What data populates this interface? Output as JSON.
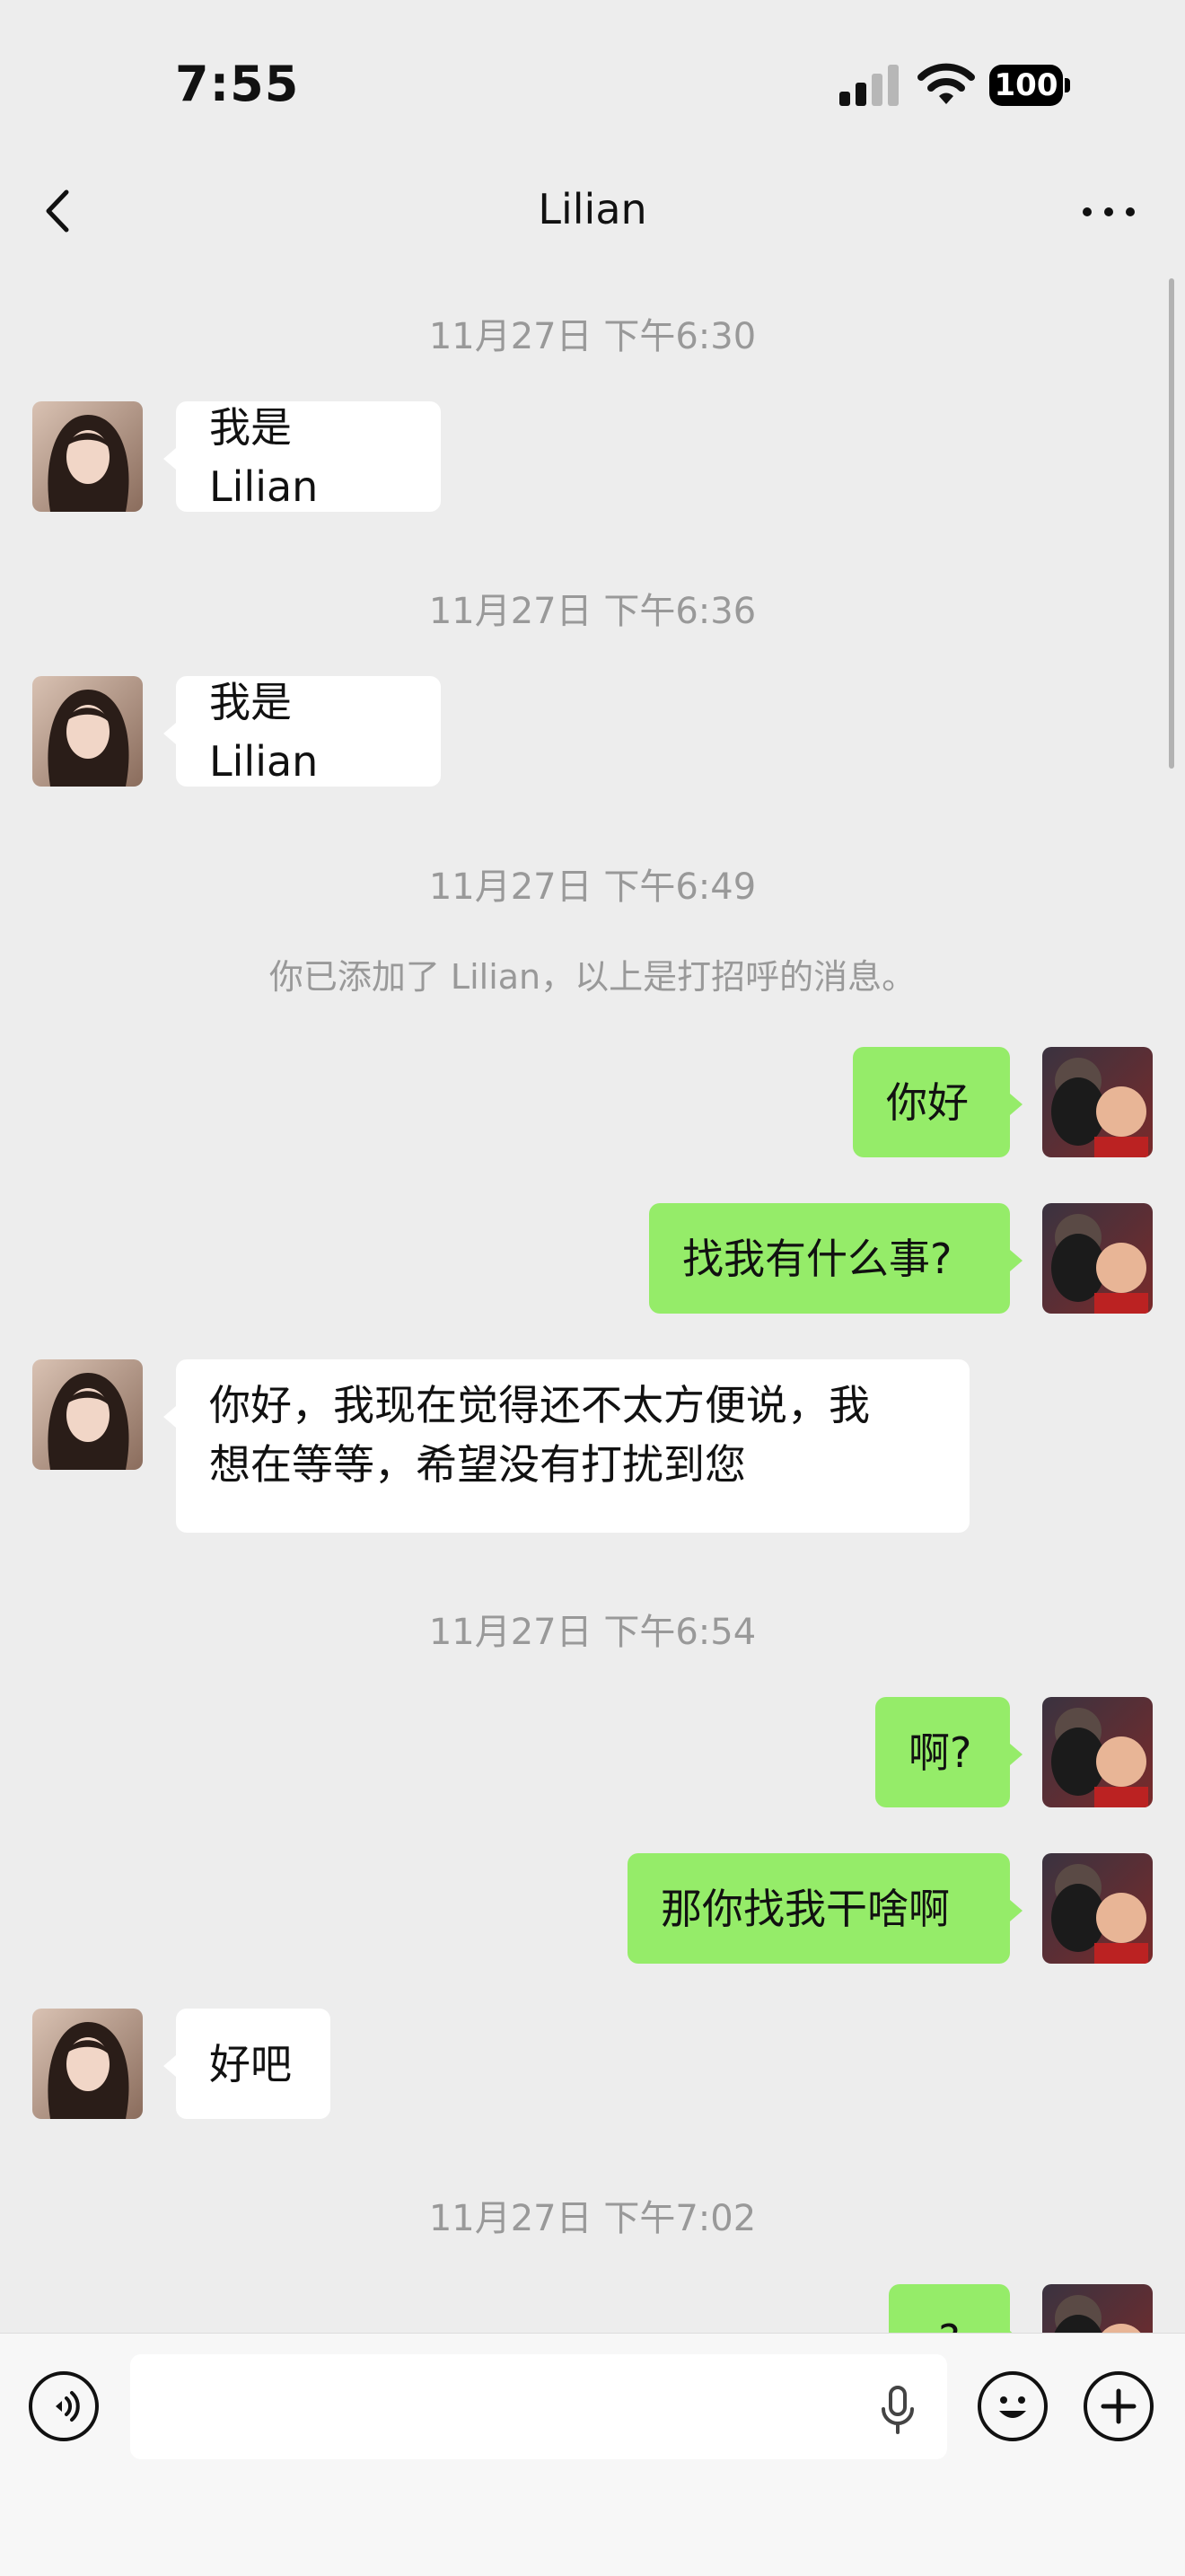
{
  "status_bar": {
    "time": "7:55",
    "battery": "100"
  },
  "nav": {
    "title": "Lilian"
  },
  "messages": [
    {
      "type": "timestamp",
      "text": "11月27日 下午6:30"
    },
    {
      "type": "in",
      "text": "我是 Lilian"
    },
    {
      "type": "timestamp",
      "text": "11月27日 下午6:36"
    },
    {
      "type": "in",
      "text": "我是 Lilian"
    },
    {
      "type": "timestamp",
      "text": "11月27日 下午6:49"
    },
    {
      "type": "system",
      "text": "你已添加了 Lilian，以上是打招呼的消息。"
    },
    {
      "type": "out",
      "text": "你好"
    },
    {
      "type": "out",
      "text": "找我有什么事?"
    },
    {
      "type": "in",
      "line1": "你好，我现在觉得还不太方便说，我",
      "line2": "想在等等，希望没有打扰到您"
    },
    {
      "type": "timestamp",
      "text": "11月27日 下午6:54"
    },
    {
      "type": "out",
      "text": "啊?"
    },
    {
      "type": "out",
      "text": "那你找我干啥啊"
    },
    {
      "type": "in",
      "text": "好吧"
    },
    {
      "type": "timestamp",
      "text": "11月27日 下午7:02"
    },
    {
      "type": "out",
      "text": "?"
    }
  ],
  "colors": {
    "background": "#ededed",
    "bubble_out": "#95ec69",
    "bubble_in": "#ffffff",
    "timestamp": "#999999"
  },
  "icons": [
    "back-chevron-icon",
    "more-dots-icon",
    "voice-icon",
    "microphone-icon",
    "emoji-icon",
    "plus-icon"
  ]
}
